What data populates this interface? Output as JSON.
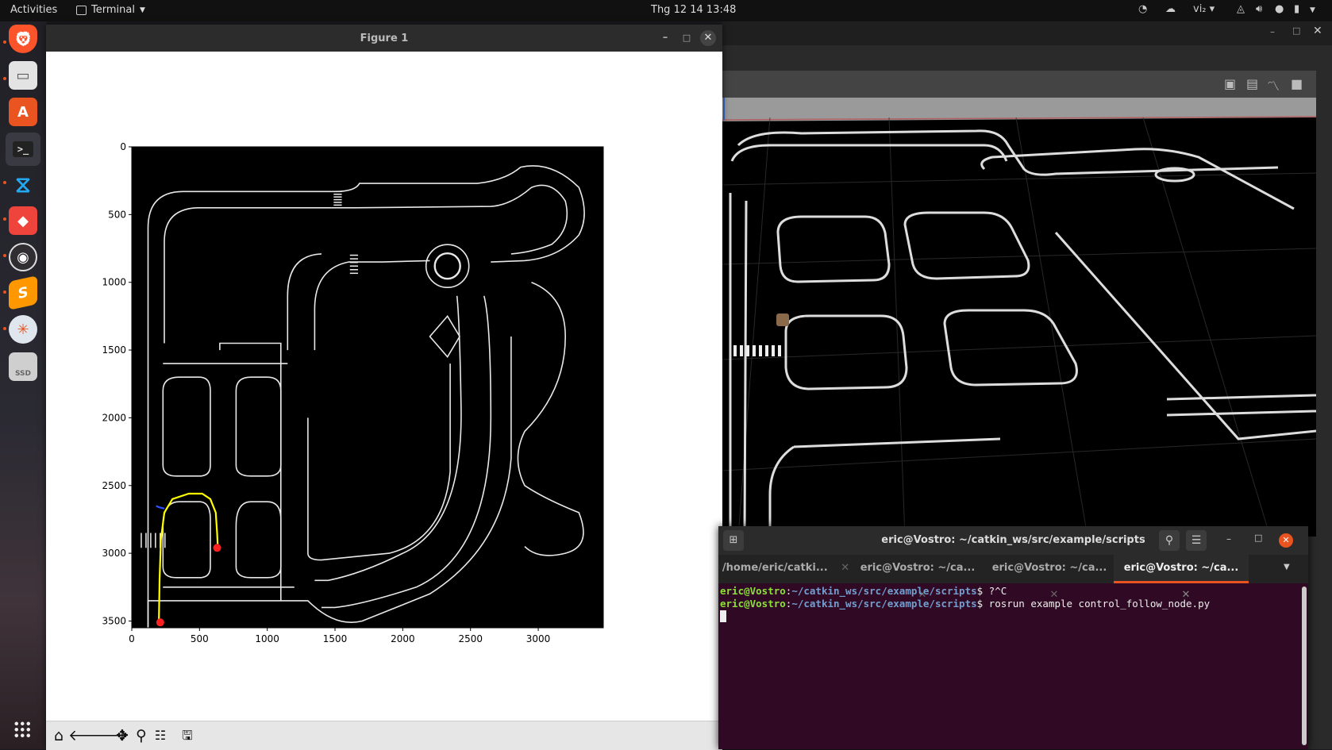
{
  "topbar": {
    "activities": "Activities",
    "app_menu": "Terminal",
    "clock": "Thg 12 14  13:48",
    "input_method": "vi₂"
  },
  "dock": {
    "items": [
      {
        "name": "brave-browser",
        "icon": "lion-icon",
        "color": "#fb542b"
      },
      {
        "name": "files",
        "icon": "folder-icon",
        "color": "#e8e8e8"
      },
      {
        "name": "software-center",
        "icon": "shopping-bag-icon",
        "color": "#e95420"
      },
      {
        "name": "terminal",
        "icon": "terminal-icon",
        "color": "#2e2e2e"
      },
      {
        "name": "vscode",
        "icon": "vscode-icon",
        "color": "#23a9f2"
      },
      {
        "name": "anydesk",
        "icon": "anydesk-icon",
        "color": "#ef443b"
      },
      {
        "name": "obs-studio",
        "icon": "obs-icon",
        "color": "#302e31"
      },
      {
        "name": "sublime-text",
        "icon": "sublime-icon",
        "color": "#ff9800"
      },
      {
        "name": "rqt",
        "icon": "pinwheel-icon",
        "color": "#dfe6ee"
      },
      {
        "name": "disk",
        "icon": "ssd-icon",
        "color": "#cfcfcf"
      }
    ],
    "ssd_label": "SSD"
  },
  "figure": {
    "title": "Figure 1",
    "toolbar": [
      "home-icon",
      "back-icon",
      "forward-icon",
      "pan-icon",
      "zoom-icon",
      "configure-icon",
      "save-icon"
    ]
  },
  "chart_data": {
    "type": "scatter",
    "title": "",
    "xlabel": "",
    "ylabel": "",
    "xlim": [
      0,
      3480
    ],
    "ylim": [
      3550,
      0
    ],
    "y_inverted": true,
    "xticks": [
      0,
      500,
      1000,
      1500,
      2000,
      2500,
      3000
    ],
    "yticks": [
      0,
      500,
      1000,
      1500,
      2000,
      2500,
      3000,
      3500
    ],
    "background": "#000000",
    "series": [
      {
        "type": "line",
        "color": "#ffff00",
        "x": [
          200,
          205,
          215,
          240,
          300,
          420,
          520,
          580,
          620,
          630,
          635
        ],
        "y": [
          3520,
          3200,
          2900,
          2700,
          2600,
          2560,
          2560,
          2600,
          2700,
          2850,
          2960
        ]
      },
      {
        "type": "line",
        "color": "#3050ff",
        "x": [
          180,
          200,
          220,
          240
        ],
        "y": [
          2650,
          2660,
          2665,
          2670
        ]
      },
      {
        "type": "points",
        "color": "#ff2020",
        "x": [
          210,
          630
        ],
        "y": [
          3510,
          2960
        ]
      }
    ]
  },
  "gazebo": {
    "toolbar_icons": [
      "camera-icon",
      "log-icon",
      "plot-icon",
      "video-icon"
    ]
  },
  "terminal": {
    "title": "eric@Vostro: ~/catkin_ws/src/example/scripts",
    "tabs": [
      {
        "label": "/home/eric/catki...",
        "active": false
      },
      {
        "label": "eric@Vostro: ~/ca...",
        "active": false
      },
      {
        "label": "eric@Vostro: ~/ca...",
        "active": false
      },
      {
        "label": "eric@Vostro: ~/ca...",
        "active": true
      }
    ],
    "lines": [
      {
        "user": "eric@Vostro",
        "path": "~/catkin_ws/src/example/scripts",
        "cmd": "$ ?^C"
      },
      {
        "user": "eric@Vostro",
        "path": "~/catkin_ws/src/example/scripts",
        "cmd": "$ rosrun example control_follow_node.py"
      }
    ]
  }
}
